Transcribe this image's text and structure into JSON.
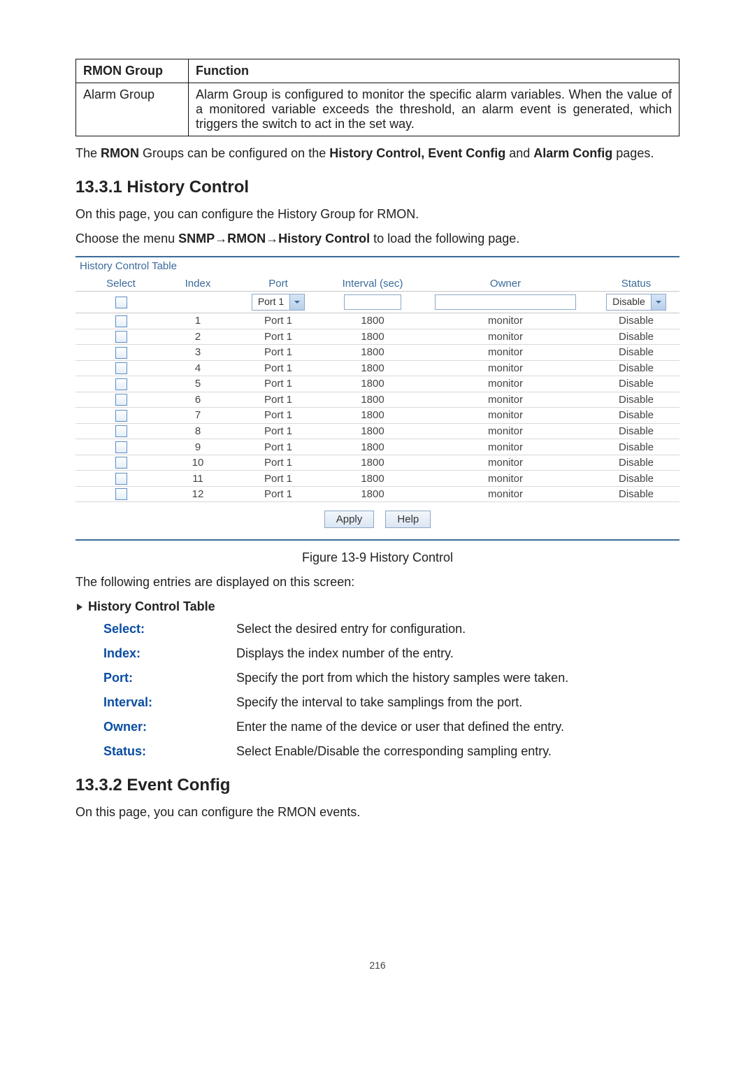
{
  "info_table": {
    "header": {
      "col1": "RMON Group",
      "col2": "Function"
    },
    "row": {
      "group": "Alarm Group",
      "desc": "Alarm Group is configured to monitor the specific alarm variables. When the value of a monitored variable exceeds the threshold, an alarm event is generated, which triggers the switch to act in the set way."
    }
  },
  "para1_pre": "The ",
  "para1_b1": "RMON",
  "para1_mid": " Groups can be configured on the ",
  "para1_b2": "History Control, Event Config",
  "para1_and": " and ",
  "para1_b3": "Alarm Config",
  "para1_post": " pages.",
  "head1": "13.3.1  History Control",
  "para2": "On this page, you can configure the History Group for RMON.",
  "para3_pre": "Choose the menu ",
  "para3_b": "SNMP→RMON→History Control",
  "para3_post": " to load the following page.",
  "ui": {
    "panel_title": "History Control Table",
    "cols": {
      "select": "Select",
      "index": "Index",
      "port": "Port",
      "interval": "Interval (sec)",
      "owner": "Owner",
      "status": "Status"
    },
    "filter": {
      "port_sel": "Port 1",
      "status_sel": "Disable"
    },
    "rows": [
      {
        "index": "1",
        "port": "Port 1",
        "interval": "1800",
        "owner": "monitor",
        "status": "Disable"
      },
      {
        "index": "2",
        "port": "Port 1",
        "interval": "1800",
        "owner": "monitor",
        "status": "Disable"
      },
      {
        "index": "3",
        "port": "Port 1",
        "interval": "1800",
        "owner": "monitor",
        "status": "Disable"
      },
      {
        "index": "4",
        "port": "Port 1",
        "interval": "1800",
        "owner": "monitor",
        "status": "Disable"
      },
      {
        "index": "5",
        "port": "Port 1",
        "interval": "1800",
        "owner": "monitor",
        "status": "Disable"
      },
      {
        "index": "6",
        "port": "Port 1",
        "interval": "1800",
        "owner": "monitor",
        "status": "Disable"
      },
      {
        "index": "7",
        "port": "Port 1",
        "interval": "1800",
        "owner": "monitor",
        "status": "Disable"
      },
      {
        "index": "8",
        "port": "Port 1",
        "interval": "1800",
        "owner": "monitor",
        "status": "Disable"
      },
      {
        "index": "9",
        "port": "Port 1",
        "interval": "1800",
        "owner": "monitor",
        "status": "Disable"
      },
      {
        "index": "10",
        "port": "Port 1",
        "interval": "1800",
        "owner": "monitor",
        "status": "Disable"
      },
      {
        "index": "11",
        "port": "Port 1",
        "interval": "1800",
        "owner": "monitor",
        "status": "Disable"
      },
      {
        "index": "12",
        "port": "Port 1",
        "interval": "1800",
        "owner": "monitor",
        "status": "Disable"
      }
    ],
    "buttons": {
      "apply": "Apply",
      "help": "Help"
    }
  },
  "figcap": "Figure 13-9 History Control",
  "para4": "The following entries are displayed on this screen:",
  "entries_head": "History Control Table",
  "fields": [
    {
      "label": "Select:",
      "desc": "Select the desired entry for configuration."
    },
    {
      "label": "Index:",
      "desc": "Displays the index number of the entry."
    },
    {
      "label": "Port:",
      "desc": "Specify the port from which the history samples were taken."
    },
    {
      "label": "Interval:",
      "desc": "Specify the interval to take samplings from the port."
    },
    {
      "label": "Owner:",
      "desc": "Enter the name of the device or user that defined the entry."
    },
    {
      "label": "Status:",
      "desc": "Select Enable/Disable the corresponding sampling entry."
    }
  ],
  "head2": "13.3.2  Event Config",
  "para5": "On this page, you can configure the RMON events.",
  "pagenum": "216"
}
